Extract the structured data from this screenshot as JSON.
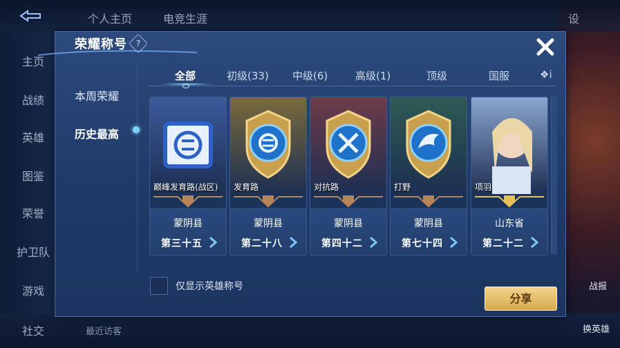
{
  "background": {
    "top_tabs": [
      "个人主页",
      "电竞生涯"
    ],
    "side_nav": [
      "主页",
      "战绩",
      "英雄",
      "图鉴",
      "荣誉",
      "护卫队",
      "游戏",
      "社交"
    ],
    "top_right": "设",
    "right_labels": [
      "战报",
      "换英雄"
    ],
    "bottom_text": "最近访客"
  },
  "modal": {
    "title": "荣耀称号",
    "help_glyph": "?",
    "left_tabs": [
      "本周荣耀",
      "历史最高"
    ],
    "active_left_tab": "历史最高",
    "category_tabs": [
      "全部",
      "初级(33)",
      "中级(6)",
      "高级(1)",
      "顶级",
      "国服",
      "❖i"
    ],
    "active_category": "全部",
    "cards": [
      {
        "name": "巅峰发育路(战区)",
        "region": "蒙阴县",
        "rank": "第三十五",
        "emblem": "farm-lane-icon",
        "tier": "bronze",
        "art_color": "#3a5a9a"
      },
      {
        "name": "发育路",
        "region": "蒙阴县",
        "rank": "第二十八",
        "emblem": "farm-lane-icon",
        "tier": "bronze",
        "art_color": "#7a6a3c"
      },
      {
        "name": "对抗路",
        "region": "蒙阴县",
        "rank": "第四十二",
        "emblem": "crossed-swords-icon",
        "tier": "bronze",
        "art_color": "#6e3b4a"
      },
      {
        "name": "打野",
        "region": "蒙阴县",
        "rank": "第七十四",
        "emblem": "dragon-icon",
        "tier": "bronze",
        "art_color": "#2e5b53"
      },
      {
        "name": "项羽",
        "region": "山东省",
        "rank": "第二十二",
        "emblem": "hero-portrait",
        "tier": "gold",
        "art_color": "#8aa5cf"
      }
    ],
    "checkbox_label": "仅显示英雄称号",
    "share_label": "分享"
  },
  "colors": {
    "accent_blue": "#7fd3ff",
    "modal_bg": "#24406f",
    "share_gold": "#e6bd6c",
    "ribbon_bronze": "#b9845a",
    "ribbon_gold": "#e7c15a"
  }
}
